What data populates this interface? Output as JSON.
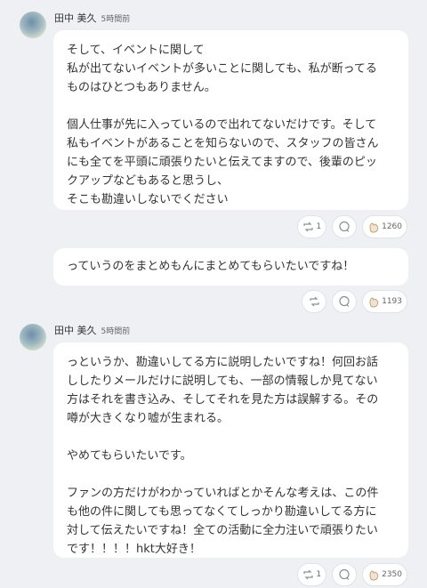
{
  "posts": [
    {
      "author": "田中 美久",
      "time": "5時間前",
      "paragraphs": [
        "そして、イベントに関して\n私が出てないイベントが多いことに関しても、私が断ってる\nものはひとつもありません。",
        "個人仕事が先に入っているので出れてないだけです。そして\n私もイベントがあることを知らないので、スタッフの皆さん\nにも全てを平頭に頑張りたいと伝えてますので、後輩のピッ\nクアップなどもあると思うし、\nそこも勘違いしないでください"
      ],
      "repost_count": "1",
      "like_count": "1260",
      "icons": [
        "repost-icon",
        "comment-icon",
        "like-hand-icon"
      ]
    },
    {
      "author": "",
      "time": "",
      "paragraphs": [
        "っていうのをまとめもんにまとめてもらいたいですね！"
      ],
      "repost_count": "",
      "like_count": "1193",
      "icons": [
        "repost-icon",
        "comment-icon",
        "like-hand-icon"
      ]
    },
    {
      "author": "田中 美久",
      "time": "5時間前",
      "paragraphs": [
        "っというか、勘違いしてる方に説明したいですね！何回お話\nししたりメールだけに説明しても、一部の情報しか見てない\n方はそれを書き込み、そしてそれを見た方は誤解する。その\n噂が大きくなり嘘が生まれる。",
        "やめてもらいたいです。",
        "ファンの方だけがわかっていればとかそんな考えは、この件\nも他の件に関しても思ってなくてしっかり勘違いしてる方に\n対して伝えたいですね！全ての活動に全力注いで頑張りたい\nです！！！！hkt大好き！"
      ],
      "repost_count": "1",
      "like_count": "2350",
      "icons": [
        "repost-icon",
        "comment-icon",
        "like-hand-icon"
      ]
    }
  ]
}
